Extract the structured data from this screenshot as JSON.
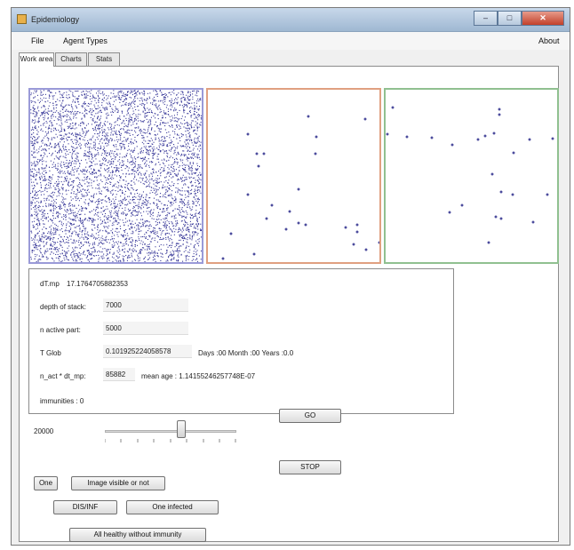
{
  "window": {
    "title": "Epidemiology",
    "buttons": {
      "minimize": "–",
      "maximize": "□",
      "close": "✕"
    }
  },
  "menu": {
    "file": "File",
    "agent_types": "Agent Types",
    "about": "About"
  },
  "tabs": [
    {
      "label": "Work area",
      "active": true
    },
    {
      "label": "Charts",
      "active": false
    },
    {
      "label": "Stats",
      "active": false
    }
  ],
  "panels": {
    "population": {
      "border_color": "#9a9ad8",
      "dot_color": "#3a3a9a",
      "point_count": 5000
    },
    "infected": {
      "border_color": "#e0a080",
      "dot_color": "#2a2a8a",
      "points": [
        [
          113,
          30
        ],
        [
          177,
          33
        ],
        [
          45,
          50
        ],
        [
          122,
          53
        ],
        [
          55,
          72
        ],
        [
          63,
          72
        ],
        [
          121,
          72
        ],
        [
          57,
          86
        ],
        [
          102,
          112
        ],
        [
          45,
          118
        ],
        [
          72,
          130
        ],
        [
          66,
          145
        ],
        [
          92,
          137
        ],
        [
          102,
          150
        ],
        [
          110,
          152
        ],
        [
          88,
          157
        ],
        [
          26,
          162
        ],
        [
          155,
          155
        ],
        [
          168,
          152
        ],
        [
          168,
          160
        ],
        [
          164,
          174
        ],
        [
          193,
          172
        ],
        [
          178,
          180
        ],
        [
          52,
          185
        ],
        [
          17,
          190
        ]
      ]
    },
    "recovered": {
      "border_color": "#90c090",
      "dot_color": "#2a2a8a",
      "points": [
        [
          8,
          20
        ],
        [
          128,
          22
        ],
        [
          128,
          28
        ],
        [
          196,
          40
        ],
        [
          2,
          50
        ],
        [
          24,
          53
        ],
        [
          52,
          54
        ],
        [
          104,
          56
        ],
        [
          112,
          52
        ],
        [
          122,
          49
        ],
        [
          162,
          56
        ],
        [
          188,
          55
        ],
        [
          75,
          62
        ],
        [
          144,
          71
        ],
        [
          120,
          95
        ],
        [
          130,
          115
        ],
        [
          143,
          118
        ],
        [
          182,
          118
        ],
        [
          86,
          130
        ],
        [
          72,
          138
        ],
        [
          124,
          143
        ],
        [
          130,
          145
        ],
        [
          166,
          149
        ],
        [
          116,
          172
        ],
        [
          10,
          198
        ],
        [
          25,
          198
        ]
      ]
    }
  },
  "info": {
    "dt_label": "dT.mp",
    "dt_value": "17.1764705882353",
    "depth_label": "depth of stack:",
    "depth_value": "7000",
    "active_label": "n active part:",
    "active_value": "5000",
    "tglob_label": "T Glob",
    "tglob_value": "0.101925224058578",
    "time_text": "Days :00 Month :00 Years :0.0",
    "nact_label": "n_act * dt_mp:",
    "nact_value": "85882",
    "mean_age": "mean age : 1.14155246257748E-07",
    "immunities": "immunities : 0"
  },
  "controls": {
    "slider_value": "20000",
    "slider_level_fraction": 0.58,
    "go": "GO",
    "stop": "STOP",
    "one": "One",
    "image_visible": "Image visible or not",
    "dis_inf": "DIS/INF",
    "one_infected": "One infected",
    "all_healthy": "All healthy without immunity"
  }
}
